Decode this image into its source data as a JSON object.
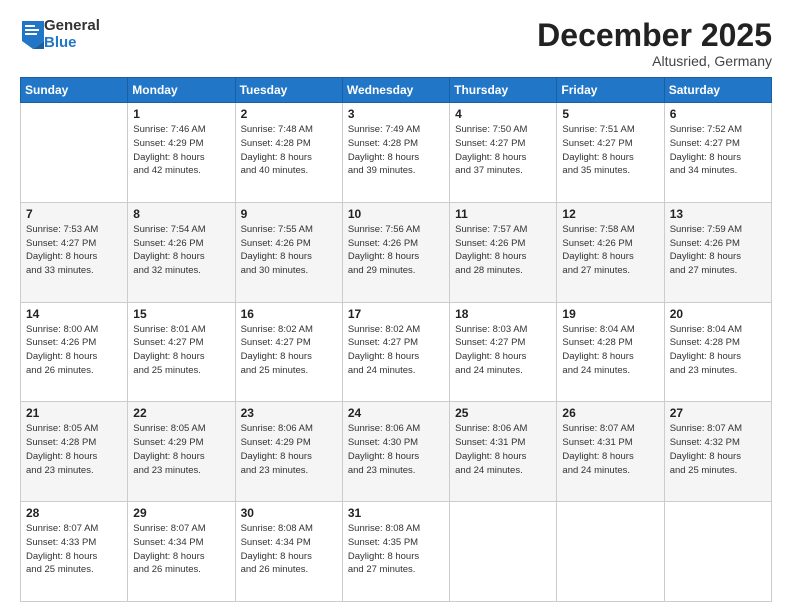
{
  "logo": {
    "general": "General",
    "blue": "Blue"
  },
  "header": {
    "month": "December 2025",
    "location": "Altusried, Germany"
  },
  "weekdays": [
    "Sunday",
    "Monday",
    "Tuesday",
    "Wednesday",
    "Thursday",
    "Friday",
    "Saturday"
  ],
  "weeks": [
    [
      {
        "day": "",
        "info": ""
      },
      {
        "day": "1",
        "info": "Sunrise: 7:46 AM\nSunset: 4:29 PM\nDaylight: 8 hours\nand 42 minutes."
      },
      {
        "day": "2",
        "info": "Sunrise: 7:48 AM\nSunset: 4:28 PM\nDaylight: 8 hours\nand 40 minutes."
      },
      {
        "day": "3",
        "info": "Sunrise: 7:49 AM\nSunset: 4:28 PM\nDaylight: 8 hours\nand 39 minutes."
      },
      {
        "day": "4",
        "info": "Sunrise: 7:50 AM\nSunset: 4:27 PM\nDaylight: 8 hours\nand 37 minutes."
      },
      {
        "day": "5",
        "info": "Sunrise: 7:51 AM\nSunset: 4:27 PM\nDaylight: 8 hours\nand 35 minutes."
      },
      {
        "day": "6",
        "info": "Sunrise: 7:52 AM\nSunset: 4:27 PM\nDaylight: 8 hours\nand 34 minutes."
      }
    ],
    [
      {
        "day": "7",
        "info": "Sunrise: 7:53 AM\nSunset: 4:27 PM\nDaylight: 8 hours\nand 33 minutes."
      },
      {
        "day": "8",
        "info": "Sunrise: 7:54 AM\nSunset: 4:26 PM\nDaylight: 8 hours\nand 32 minutes."
      },
      {
        "day": "9",
        "info": "Sunrise: 7:55 AM\nSunset: 4:26 PM\nDaylight: 8 hours\nand 30 minutes."
      },
      {
        "day": "10",
        "info": "Sunrise: 7:56 AM\nSunset: 4:26 PM\nDaylight: 8 hours\nand 29 minutes."
      },
      {
        "day": "11",
        "info": "Sunrise: 7:57 AM\nSunset: 4:26 PM\nDaylight: 8 hours\nand 28 minutes."
      },
      {
        "day": "12",
        "info": "Sunrise: 7:58 AM\nSunset: 4:26 PM\nDaylight: 8 hours\nand 27 minutes."
      },
      {
        "day": "13",
        "info": "Sunrise: 7:59 AM\nSunset: 4:26 PM\nDaylight: 8 hours\nand 27 minutes."
      }
    ],
    [
      {
        "day": "14",
        "info": "Sunrise: 8:00 AM\nSunset: 4:26 PM\nDaylight: 8 hours\nand 26 minutes."
      },
      {
        "day": "15",
        "info": "Sunrise: 8:01 AM\nSunset: 4:27 PM\nDaylight: 8 hours\nand 25 minutes."
      },
      {
        "day": "16",
        "info": "Sunrise: 8:02 AM\nSunset: 4:27 PM\nDaylight: 8 hours\nand 25 minutes."
      },
      {
        "day": "17",
        "info": "Sunrise: 8:02 AM\nSunset: 4:27 PM\nDaylight: 8 hours\nand 24 minutes."
      },
      {
        "day": "18",
        "info": "Sunrise: 8:03 AM\nSunset: 4:27 PM\nDaylight: 8 hours\nand 24 minutes."
      },
      {
        "day": "19",
        "info": "Sunrise: 8:04 AM\nSunset: 4:28 PM\nDaylight: 8 hours\nand 24 minutes."
      },
      {
        "day": "20",
        "info": "Sunrise: 8:04 AM\nSunset: 4:28 PM\nDaylight: 8 hours\nand 23 minutes."
      }
    ],
    [
      {
        "day": "21",
        "info": "Sunrise: 8:05 AM\nSunset: 4:28 PM\nDaylight: 8 hours\nand 23 minutes."
      },
      {
        "day": "22",
        "info": "Sunrise: 8:05 AM\nSunset: 4:29 PM\nDaylight: 8 hours\nand 23 minutes."
      },
      {
        "day": "23",
        "info": "Sunrise: 8:06 AM\nSunset: 4:29 PM\nDaylight: 8 hours\nand 23 minutes."
      },
      {
        "day": "24",
        "info": "Sunrise: 8:06 AM\nSunset: 4:30 PM\nDaylight: 8 hours\nand 23 minutes."
      },
      {
        "day": "25",
        "info": "Sunrise: 8:06 AM\nSunset: 4:31 PM\nDaylight: 8 hours\nand 24 minutes."
      },
      {
        "day": "26",
        "info": "Sunrise: 8:07 AM\nSunset: 4:31 PM\nDaylight: 8 hours\nand 24 minutes."
      },
      {
        "day": "27",
        "info": "Sunrise: 8:07 AM\nSunset: 4:32 PM\nDaylight: 8 hours\nand 25 minutes."
      }
    ],
    [
      {
        "day": "28",
        "info": "Sunrise: 8:07 AM\nSunset: 4:33 PM\nDaylight: 8 hours\nand 25 minutes."
      },
      {
        "day": "29",
        "info": "Sunrise: 8:07 AM\nSunset: 4:34 PM\nDaylight: 8 hours\nand 26 minutes."
      },
      {
        "day": "30",
        "info": "Sunrise: 8:08 AM\nSunset: 4:34 PM\nDaylight: 8 hours\nand 26 minutes."
      },
      {
        "day": "31",
        "info": "Sunrise: 8:08 AM\nSunset: 4:35 PM\nDaylight: 8 hours\nand 27 minutes."
      },
      {
        "day": "",
        "info": ""
      },
      {
        "day": "",
        "info": ""
      },
      {
        "day": "",
        "info": ""
      }
    ]
  ]
}
